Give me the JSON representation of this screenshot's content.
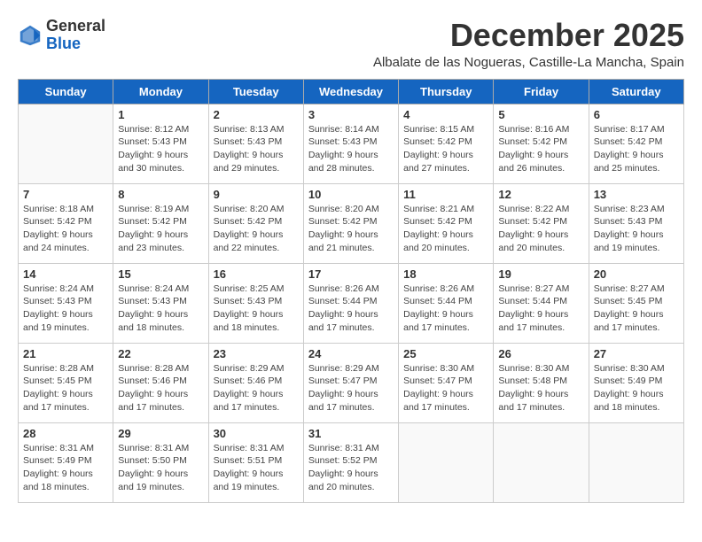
{
  "header": {
    "logo_line1": "General",
    "logo_line2": "Blue",
    "month_title": "December 2025",
    "subtitle": "Albalate de las Nogueras, Castille-La Mancha, Spain"
  },
  "days_of_week": [
    "Sunday",
    "Monday",
    "Tuesday",
    "Wednesday",
    "Thursday",
    "Friday",
    "Saturday"
  ],
  "weeks": [
    [
      {
        "day": "",
        "info": ""
      },
      {
        "day": "1",
        "info": "Sunrise: 8:12 AM\nSunset: 5:43 PM\nDaylight: 9 hours\nand 30 minutes."
      },
      {
        "day": "2",
        "info": "Sunrise: 8:13 AM\nSunset: 5:43 PM\nDaylight: 9 hours\nand 29 minutes."
      },
      {
        "day": "3",
        "info": "Sunrise: 8:14 AM\nSunset: 5:43 PM\nDaylight: 9 hours\nand 28 minutes."
      },
      {
        "day": "4",
        "info": "Sunrise: 8:15 AM\nSunset: 5:42 PM\nDaylight: 9 hours\nand 27 minutes."
      },
      {
        "day": "5",
        "info": "Sunrise: 8:16 AM\nSunset: 5:42 PM\nDaylight: 9 hours\nand 26 minutes."
      },
      {
        "day": "6",
        "info": "Sunrise: 8:17 AM\nSunset: 5:42 PM\nDaylight: 9 hours\nand 25 minutes."
      }
    ],
    [
      {
        "day": "7",
        "info": "Sunrise: 8:18 AM\nSunset: 5:42 PM\nDaylight: 9 hours\nand 24 minutes."
      },
      {
        "day": "8",
        "info": "Sunrise: 8:19 AM\nSunset: 5:42 PM\nDaylight: 9 hours\nand 23 minutes."
      },
      {
        "day": "9",
        "info": "Sunrise: 8:20 AM\nSunset: 5:42 PM\nDaylight: 9 hours\nand 22 minutes."
      },
      {
        "day": "10",
        "info": "Sunrise: 8:20 AM\nSunset: 5:42 PM\nDaylight: 9 hours\nand 21 minutes."
      },
      {
        "day": "11",
        "info": "Sunrise: 8:21 AM\nSunset: 5:42 PM\nDaylight: 9 hours\nand 20 minutes."
      },
      {
        "day": "12",
        "info": "Sunrise: 8:22 AM\nSunset: 5:42 PM\nDaylight: 9 hours\nand 20 minutes."
      },
      {
        "day": "13",
        "info": "Sunrise: 8:23 AM\nSunset: 5:43 PM\nDaylight: 9 hours\nand 19 minutes."
      }
    ],
    [
      {
        "day": "14",
        "info": "Sunrise: 8:24 AM\nSunset: 5:43 PM\nDaylight: 9 hours\nand 19 minutes."
      },
      {
        "day": "15",
        "info": "Sunrise: 8:24 AM\nSunset: 5:43 PM\nDaylight: 9 hours\nand 18 minutes."
      },
      {
        "day": "16",
        "info": "Sunrise: 8:25 AM\nSunset: 5:43 PM\nDaylight: 9 hours\nand 18 minutes."
      },
      {
        "day": "17",
        "info": "Sunrise: 8:26 AM\nSunset: 5:44 PM\nDaylight: 9 hours\nand 17 minutes."
      },
      {
        "day": "18",
        "info": "Sunrise: 8:26 AM\nSunset: 5:44 PM\nDaylight: 9 hours\nand 17 minutes."
      },
      {
        "day": "19",
        "info": "Sunrise: 8:27 AM\nSunset: 5:44 PM\nDaylight: 9 hours\nand 17 minutes."
      },
      {
        "day": "20",
        "info": "Sunrise: 8:27 AM\nSunset: 5:45 PM\nDaylight: 9 hours\nand 17 minutes."
      }
    ],
    [
      {
        "day": "21",
        "info": "Sunrise: 8:28 AM\nSunset: 5:45 PM\nDaylight: 9 hours\nand 17 minutes."
      },
      {
        "day": "22",
        "info": "Sunrise: 8:28 AM\nSunset: 5:46 PM\nDaylight: 9 hours\nand 17 minutes."
      },
      {
        "day": "23",
        "info": "Sunrise: 8:29 AM\nSunset: 5:46 PM\nDaylight: 9 hours\nand 17 minutes."
      },
      {
        "day": "24",
        "info": "Sunrise: 8:29 AM\nSunset: 5:47 PM\nDaylight: 9 hours\nand 17 minutes."
      },
      {
        "day": "25",
        "info": "Sunrise: 8:30 AM\nSunset: 5:47 PM\nDaylight: 9 hours\nand 17 minutes."
      },
      {
        "day": "26",
        "info": "Sunrise: 8:30 AM\nSunset: 5:48 PM\nDaylight: 9 hours\nand 17 minutes."
      },
      {
        "day": "27",
        "info": "Sunrise: 8:30 AM\nSunset: 5:49 PM\nDaylight: 9 hours\nand 18 minutes."
      }
    ],
    [
      {
        "day": "28",
        "info": "Sunrise: 8:31 AM\nSunset: 5:49 PM\nDaylight: 9 hours\nand 18 minutes."
      },
      {
        "day": "29",
        "info": "Sunrise: 8:31 AM\nSunset: 5:50 PM\nDaylight: 9 hours\nand 19 minutes."
      },
      {
        "day": "30",
        "info": "Sunrise: 8:31 AM\nSunset: 5:51 PM\nDaylight: 9 hours\nand 19 minutes."
      },
      {
        "day": "31",
        "info": "Sunrise: 8:31 AM\nSunset: 5:52 PM\nDaylight: 9 hours\nand 20 minutes."
      },
      {
        "day": "",
        "info": ""
      },
      {
        "day": "",
        "info": ""
      },
      {
        "day": "",
        "info": ""
      }
    ]
  ]
}
